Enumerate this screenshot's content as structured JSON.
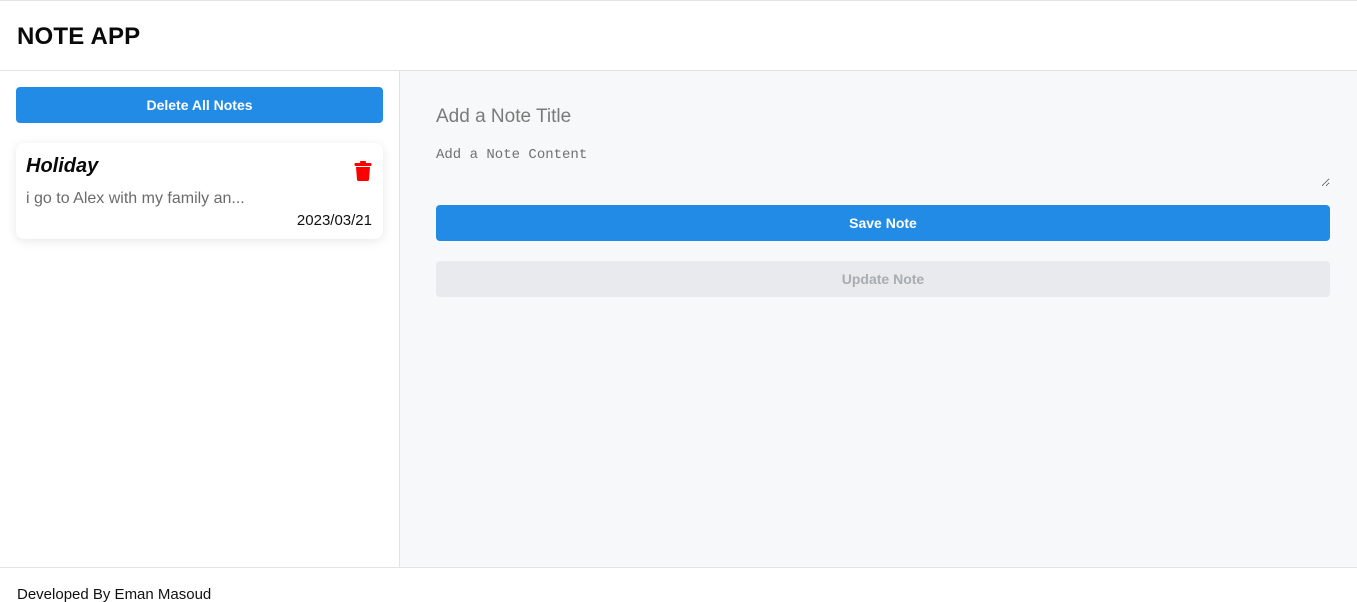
{
  "header": {
    "title": "NOTE APP"
  },
  "sidebar": {
    "delete_all_label": "Delete All Notes",
    "notes": [
      {
        "title": "Holiday",
        "preview": "i go to Alex with my family an...",
        "date": "2023/03/21",
        "delete_icon": "trash-icon"
      }
    ]
  },
  "editor": {
    "title_placeholder": "Add a Note Title",
    "title_value": "",
    "content_placeholder": "Add a Note Content",
    "content_value": "",
    "save_label": "Save Note",
    "update_label": "Update Note"
  },
  "footer": {
    "text": "Developed By Eman Masoud"
  },
  "colors": {
    "accent": "#228be6",
    "delete": "#ff0000",
    "disabled_bg": "#e8eaed",
    "editor_bg": "#f7f8f9"
  }
}
